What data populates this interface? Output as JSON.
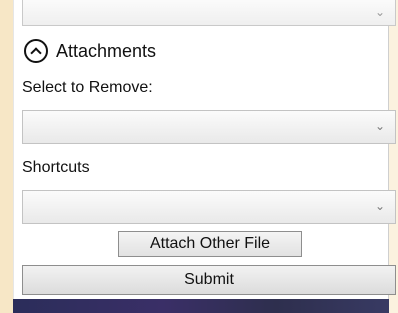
{
  "top_combo": {
    "chevron_icon": "chevron-down-icon"
  },
  "attachments": {
    "header_label": "Attachments",
    "toggle_icon": "collapse-up-icon",
    "remove": {
      "label": "Select to Remove:",
      "selected_value": "",
      "chevron_icon": "chevron-down-icon"
    },
    "shortcuts": {
      "label": "Shortcuts",
      "selected_value": "",
      "chevron_icon": "chevron-down-icon"
    },
    "attach_other_file_label": "Attach Other File"
  },
  "submit_label": "Submit",
  "colors": {
    "background": "#fbf2df",
    "panel": "#ffffff",
    "combo_border": "#c3c3c3",
    "button_border": "#8e8e8e"
  }
}
